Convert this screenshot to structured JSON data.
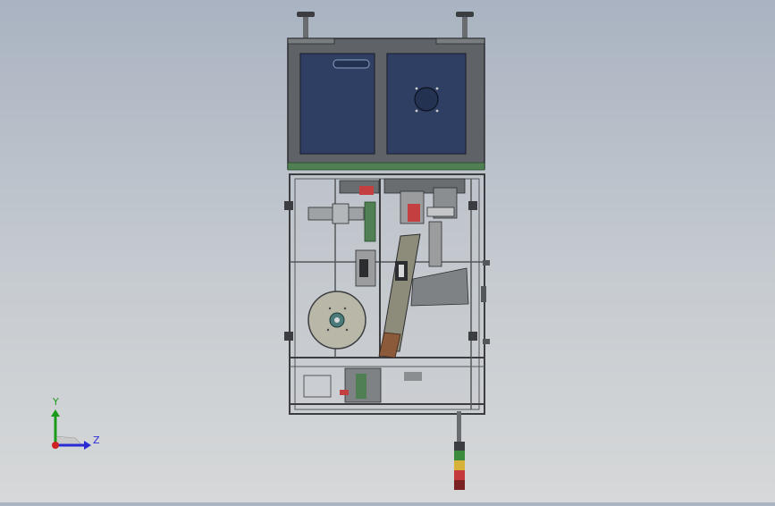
{
  "viewport": {
    "background_top": "#a9b3c1",
    "background_bottom": "#d6d8d9"
  },
  "model": {
    "frame_color": "#5f6266",
    "panel_color": "#2f3f63",
    "accent_green": "#4f7f53",
    "arm_color": "#8d8b79",
    "drum_color": "#b9b7a7",
    "brown_part": "#8a5a3a",
    "red_part": "#c44040",
    "signal_tower": {
      "colors": [
        "#3c8a3c",
        "#d6b23a",
        "#c43a3a"
      ]
    }
  },
  "triad": {
    "y_label": "Y",
    "z_label": "Z",
    "y_color": "#1a9a1a",
    "z_color": "#2b2bd6",
    "origin_color": "#cc2222"
  }
}
